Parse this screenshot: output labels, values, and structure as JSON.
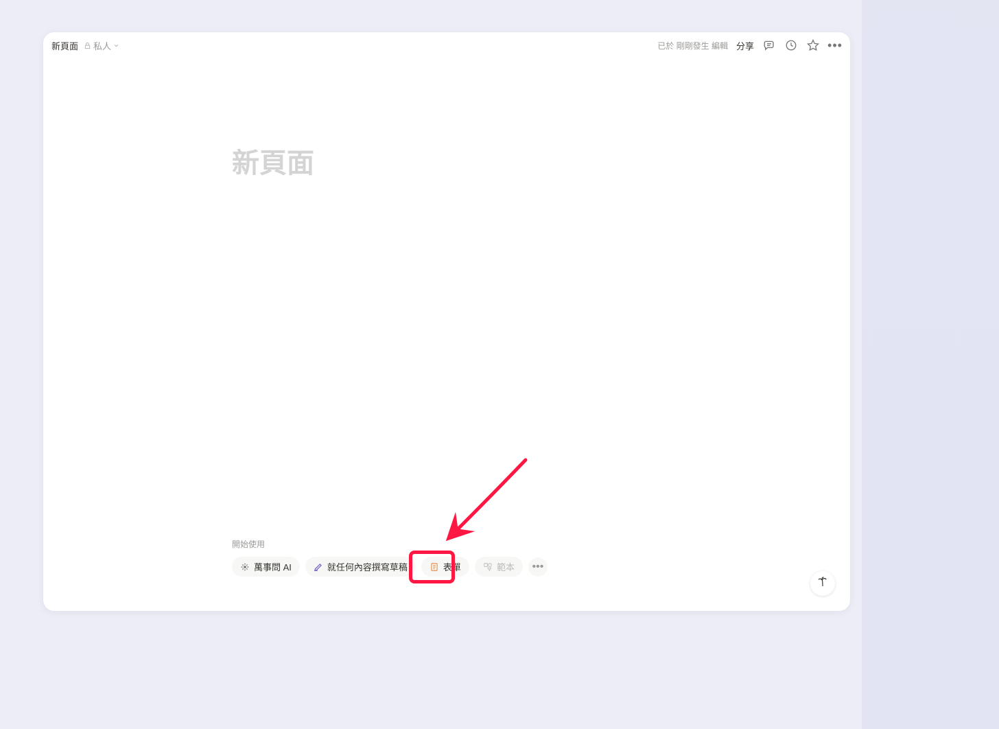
{
  "topbar": {
    "breadcrumb": "新頁面",
    "privacy_label": "私人",
    "edit_status": "已於 剛剛發生 編輯",
    "share_label": "分享"
  },
  "page": {
    "title_placeholder": "新頁面"
  },
  "get_started": {
    "label": "開始使用",
    "chips": {
      "ask_ai": "萬事問 AI",
      "draft": "就任何內容撰寫草稿",
      "form": "表單",
      "template": "範本"
    }
  },
  "icons": {
    "lock": "lock-icon",
    "chevron_down": "chevron-down-icon",
    "comment": "comment-icon",
    "clock": "clock-icon",
    "star": "star-icon",
    "more": "more-icon",
    "sparkle": "sparkle-icon",
    "pencil": "pencil-icon",
    "form": "form-icon",
    "shapes": "shapes-icon",
    "palm": "palm-icon"
  },
  "colors": {
    "accent_annotation": "#ff1744",
    "form_icon": "#e8914f",
    "draft_icon": "#6b5eca"
  }
}
